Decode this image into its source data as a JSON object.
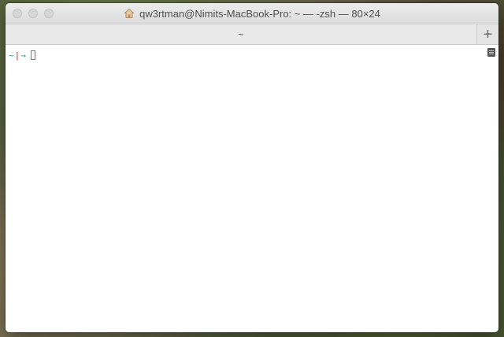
{
  "window": {
    "title": "qw3rtman@Nimits-MacBook-Pro: ~ — -zsh — 80×24"
  },
  "tabs": [
    {
      "label": "~",
      "active": true
    }
  ],
  "toolbar": {
    "new_tab_label": "+"
  },
  "terminal": {
    "prompt_dir": "~",
    "prompt_sep": "|",
    "prompt_arrow": "→",
    "input": ""
  },
  "icons": {
    "title_icon": "home-icon",
    "new_tab_icon": "plus-icon",
    "scroll_marker_icon": "scrollback-marker-icon"
  },
  "colors": {
    "prompt_dir": "#3a9aa8",
    "prompt_sep": "#c0303a",
    "prompt_arrow": "#3aa37a"
  }
}
